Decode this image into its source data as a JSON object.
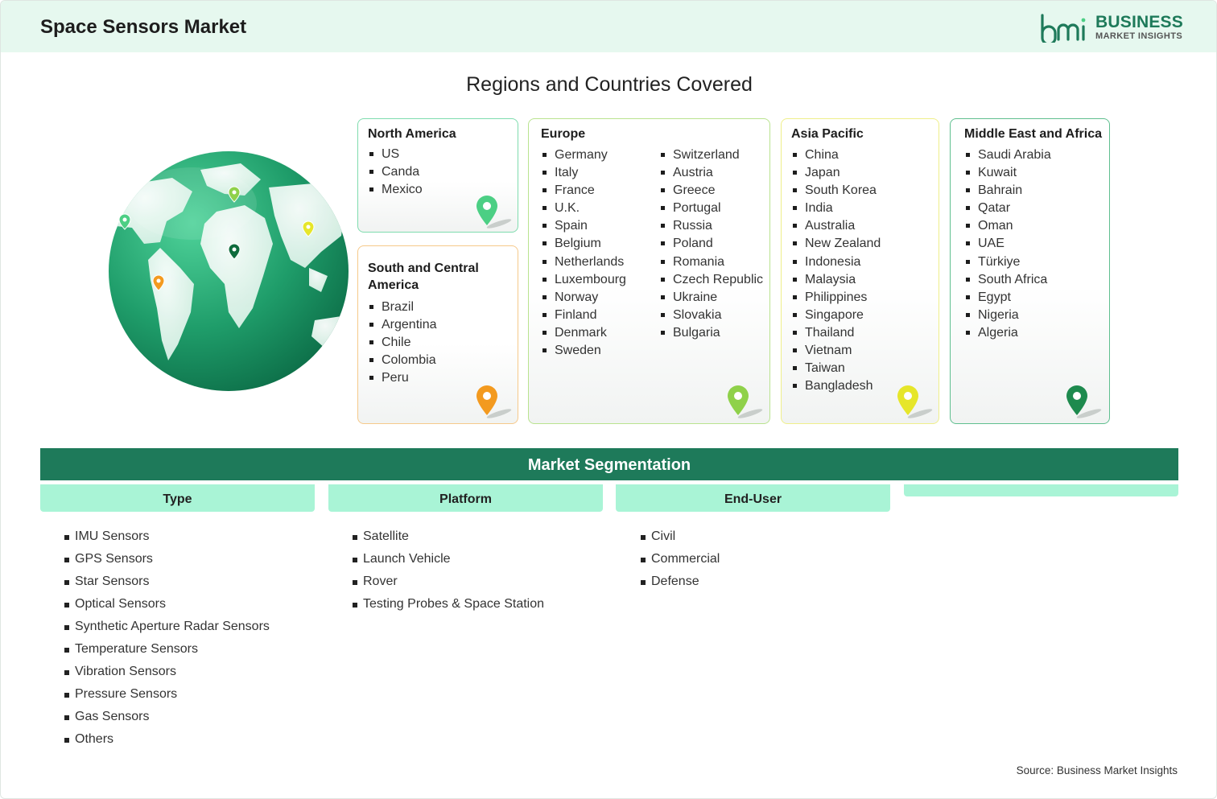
{
  "header": {
    "title": "Space Sensors Market"
  },
  "logo": {
    "line1": "BUSINESS",
    "line2": "MARKET INSIGHTS",
    "mark": "bmi"
  },
  "regions_title": "Regions and Countries Covered",
  "regions": {
    "north_america": {
      "title": "North America",
      "items": [
        "US",
        "Canda",
        "Mexico"
      ],
      "color": "#4ccf84"
    },
    "south_america": {
      "title": "South and Central America",
      "items": [
        "Brazil",
        "Argentina",
        "Chile",
        "Colombia",
        "Peru"
      ],
      "color": "#f39a1f"
    },
    "europe": {
      "title": "Europe",
      "col1": [
        "Germany",
        "Italy",
        "France",
        "U.K.",
        "Spain",
        "Belgium",
        "Netherlands",
        "Luxembourg",
        "Norway",
        "Finland",
        "Denmark",
        "Sweden"
      ],
      "col2": [
        "Switzerland",
        "Austria",
        "Greece",
        "Portugal",
        "Russia",
        "Poland",
        "Romania",
        "Czech Republic",
        "Ukraine",
        "Slovakia",
        "Bulgaria"
      ],
      "color": "#8fd14a"
    },
    "asia_pacific": {
      "title": "Asia Pacific",
      "items": [
        "China",
        "Japan",
        "South Korea",
        "India",
        "Australia",
        "New Zealand",
        "Indonesia",
        "Malaysia",
        "Philippines",
        "Singapore",
        "Thailand",
        "Vietnam",
        "Taiwan",
        "Bangladesh"
      ],
      "color": "#e6e62a"
    },
    "mea": {
      "title": "Middle East and Africa",
      "items": [
        "Saudi Arabia",
        "Kuwait",
        "Bahrain",
        "Qatar",
        "Oman",
        "UAE",
        "Türkiye",
        "South Africa",
        "Egypt",
        "Nigeria",
        "Algeria"
      ],
      "color": "#1e8a4e"
    }
  },
  "segmentation": {
    "title": "Market Segmentation",
    "type": {
      "label": "Type",
      "items": [
        "IMU Sensors",
        "GPS Sensors",
        "Star Sensors",
        "Optical Sensors",
        "Synthetic Aperture Radar Sensors",
        "Temperature Sensors",
        "Vibration Sensors",
        "Pressure Sensors",
        "Gas Sensors",
        "Others"
      ]
    },
    "platform": {
      "label": "Platform",
      "items": [
        "Satellite",
        "Launch Vehicle",
        "Rover",
        "Testing Probes & Space Station"
      ]
    },
    "end_user": {
      "label": "End-User",
      "items": [
        "Civil",
        "Commercial",
        "Defense"
      ]
    }
  },
  "source": "Source: Business Market Insights",
  "icons": [
    "globe-icon",
    "map-pin-icon",
    "bmi-logo-icon"
  ],
  "colors": {
    "primary": "#1e7a5a",
    "header_bg": "#e6f8ef",
    "segment_head": "#a9f4d6"
  }
}
